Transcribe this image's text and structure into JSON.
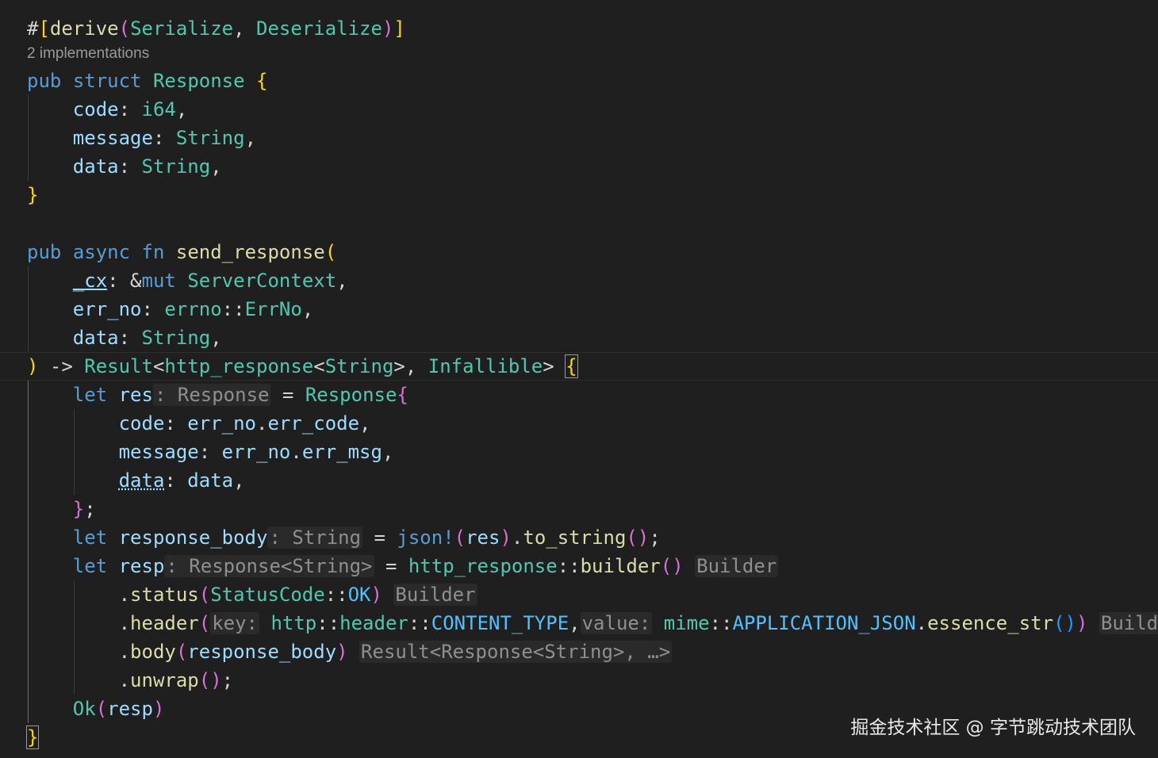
{
  "editor": {
    "codelens": "2 implementations",
    "lines": [
      {
        "t": [
          [
            "pl",
            "#"
          ],
          [
            "br1",
            "["
          ],
          [
            "attr",
            "derive"
          ],
          [
            "br2",
            "("
          ],
          [
            "ty",
            "Serialize"
          ],
          [
            "pl",
            ", "
          ],
          [
            "ty",
            "Deserialize"
          ],
          [
            "br2",
            ")"
          ],
          [
            "br1",
            "]"
          ]
        ]
      },
      {
        "t": [
          [
            "kw",
            "pub"
          ],
          [
            "pl",
            " "
          ],
          [
            "kw",
            "struct"
          ],
          [
            "pl",
            " "
          ],
          [
            "ty",
            "Response"
          ],
          [
            "pl",
            " "
          ],
          [
            "br1",
            "{"
          ]
        ]
      },
      {
        "t": [
          [
            "pl",
            "    "
          ],
          [
            "var",
            "code"
          ],
          [
            "pl",
            ": "
          ],
          [
            "ty",
            "i64"
          ],
          [
            "pl",
            ","
          ]
        ]
      },
      {
        "t": [
          [
            "pl",
            "    "
          ],
          [
            "var",
            "message"
          ],
          [
            "pl",
            ": "
          ],
          [
            "ty",
            "String"
          ],
          [
            "pl",
            ","
          ]
        ]
      },
      {
        "t": [
          [
            "pl",
            "    "
          ],
          [
            "var",
            "data"
          ],
          [
            "pl",
            ": "
          ],
          [
            "ty",
            "String"
          ],
          [
            "pl",
            ","
          ]
        ]
      },
      {
        "t": [
          [
            "br1",
            "}"
          ]
        ]
      },
      {
        "t": []
      },
      {
        "t": [
          [
            "kw",
            "pub"
          ],
          [
            "pl",
            " "
          ],
          [
            "kw",
            "async"
          ],
          [
            "pl",
            " "
          ],
          [
            "kw",
            "fn"
          ],
          [
            "pl",
            " "
          ],
          [
            "fn",
            "send_response"
          ],
          [
            "br1",
            "("
          ]
        ]
      },
      {
        "t": [
          [
            "pl",
            "    "
          ],
          [
            "var",
            "_cx"
          ],
          [
            "pl",
            ": &"
          ],
          [
            "kw",
            "mut"
          ],
          [
            "pl",
            " "
          ],
          [
            "ty",
            "ServerContext"
          ],
          [
            "pl",
            ","
          ]
        ]
      },
      {
        "t": [
          [
            "pl",
            "    "
          ],
          [
            "var",
            "err_no"
          ],
          [
            "pl",
            ": "
          ],
          [
            "ty",
            "errno"
          ],
          [
            "pl",
            "::"
          ],
          [
            "ty",
            "ErrNo"
          ],
          [
            "pl",
            ","
          ]
        ]
      },
      {
        "t": [
          [
            "pl",
            "    "
          ],
          [
            "var",
            "data"
          ],
          [
            "pl",
            ": "
          ],
          [
            "ty",
            "String"
          ],
          [
            "pl",
            ","
          ]
        ]
      },
      {
        "t": [
          [
            "br1",
            ")"
          ],
          [
            "pl",
            " -> "
          ],
          [
            "ty",
            "Result"
          ],
          [
            "pl",
            "<"
          ],
          [
            "ty",
            "http_response"
          ],
          [
            "pl",
            "<"
          ],
          [
            "ty",
            "String"
          ],
          [
            "pl",
            ">, "
          ],
          [
            "ty",
            "Infallible"
          ],
          [
            "pl",
            "> "
          ],
          [
            "br1",
            "{"
          ]
        ]
      },
      {
        "t": [
          [
            "pl",
            "    "
          ],
          [
            "kw",
            "let"
          ],
          [
            "pl",
            " "
          ],
          [
            "var",
            "res"
          ],
          [
            "hint",
            ": Response"
          ],
          [
            "pl",
            " = "
          ],
          [
            "ty",
            "Response"
          ],
          [
            "br2",
            "{"
          ]
        ]
      },
      {
        "t": [
          [
            "pl",
            "        "
          ],
          [
            "var",
            "code"
          ],
          [
            "pl",
            ": "
          ],
          [
            "var",
            "err_no"
          ],
          [
            "pl",
            "."
          ],
          [
            "var",
            "err_code"
          ],
          [
            "pl",
            ","
          ]
        ]
      },
      {
        "t": [
          [
            "pl",
            "        "
          ],
          [
            "var",
            "message"
          ],
          [
            "pl",
            ": "
          ],
          [
            "var",
            "err_no"
          ],
          [
            "pl",
            "."
          ],
          [
            "var",
            "err_msg"
          ],
          [
            "pl",
            ","
          ]
        ]
      },
      {
        "t": [
          [
            "pl",
            "        "
          ],
          [
            "var",
            "data"
          ],
          [
            "pl",
            ": "
          ],
          [
            "var",
            "data"
          ],
          [
            "pl",
            ","
          ]
        ]
      },
      {
        "t": [
          [
            "pl",
            "    "
          ],
          [
            "br2",
            "}"
          ],
          [
            "pl",
            ";"
          ]
        ]
      },
      {
        "t": [
          [
            "pl",
            "    "
          ],
          [
            "kw",
            "let"
          ],
          [
            "pl",
            " "
          ],
          [
            "var",
            "response_body"
          ],
          [
            "hint",
            ": String"
          ],
          [
            "pl",
            " = "
          ],
          [
            "macro",
            "json!"
          ],
          [
            "br2",
            "("
          ],
          [
            "var",
            "res"
          ],
          [
            "br2",
            ")"
          ],
          [
            "pl",
            "."
          ],
          [
            "fn",
            "to_string"
          ],
          [
            "br2",
            "()"
          ],
          [
            "pl",
            ";"
          ]
        ]
      },
      {
        "t": [
          [
            "pl",
            "    "
          ],
          [
            "kw",
            "let"
          ],
          [
            "pl",
            " "
          ],
          [
            "var",
            "resp"
          ],
          [
            "hint",
            ": Response<String>"
          ],
          [
            "pl",
            " = "
          ],
          [
            "ty",
            "http_response"
          ],
          [
            "pl",
            "::"
          ],
          [
            "fn",
            "builder"
          ],
          [
            "br2",
            "()"
          ],
          [
            "pl",
            " "
          ],
          [
            "hint",
            "Builder"
          ]
        ]
      },
      {
        "t": [
          [
            "pl",
            "        ."
          ],
          [
            "fn",
            "status"
          ],
          [
            "br2",
            "("
          ],
          [
            "ty",
            "StatusCode"
          ],
          [
            "pl",
            "::"
          ],
          [
            "const",
            "OK"
          ],
          [
            "br2",
            ")"
          ],
          [
            "pl",
            " "
          ],
          [
            "hint",
            "Builder"
          ]
        ]
      },
      {
        "t": [
          [
            "pl",
            "        ."
          ],
          [
            "fn",
            "header"
          ],
          [
            "br2",
            "("
          ],
          [
            "hint",
            "key:"
          ],
          [
            "pl",
            " "
          ],
          [
            "ty",
            "http"
          ],
          [
            "pl",
            "::"
          ],
          [
            "ty",
            "header"
          ],
          [
            "pl",
            "::"
          ],
          [
            "const",
            "CONTENT_TYPE"
          ],
          [
            "pl",
            ","
          ],
          [
            "hint",
            "value:"
          ],
          [
            "pl",
            " "
          ],
          [
            "ty",
            "mime"
          ],
          [
            "pl",
            "::"
          ],
          [
            "const",
            "APPLICATION_JSON"
          ],
          [
            "pl",
            "."
          ],
          [
            "fn",
            "essence_str"
          ],
          [
            "br3",
            "()"
          ],
          [
            "br2",
            ")"
          ],
          [
            "pl",
            " "
          ],
          [
            "hint",
            "Builder"
          ]
        ]
      },
      {
        "t": [
          [
            "pl",
            "        ."
          ],
          [
            "fn",
            "body"
          ],
          [
            "br2",
            "("
          ],
          [
            "var",
            "response_body"
          ],
          [
            "br2",
            ")"
          ],
          [
            "pl",
            " "
          ],
          [
            "hint",
            "Result<Response<String>, …>"
          ]
        ]
      },
      {
        "t": [
          [
            "pl",
            "        ."
          ],
          [
            "fn",
            "unwrap"
          ],
          [
            "br2",
            "()"
          ],
          [
            "pl",
            ";"
          ]
        ]
      },
      {
        "t": [
          [
            "pl",
            "    "
          ],
          [
            "ty",
            "Ok"
          ],
          [
            "br2",
            "("
          ],
          [
            "var",
            "resp"
          ],
          [
            "br2",
            ")"
          ]
        ]
      },
      {
        "t": [
          [
            "br1",
            "}"
          ]
        ]
      }
    ]
  },
  "watermark": "掘金技术社区 @ 字节跳动技术团队"
}
